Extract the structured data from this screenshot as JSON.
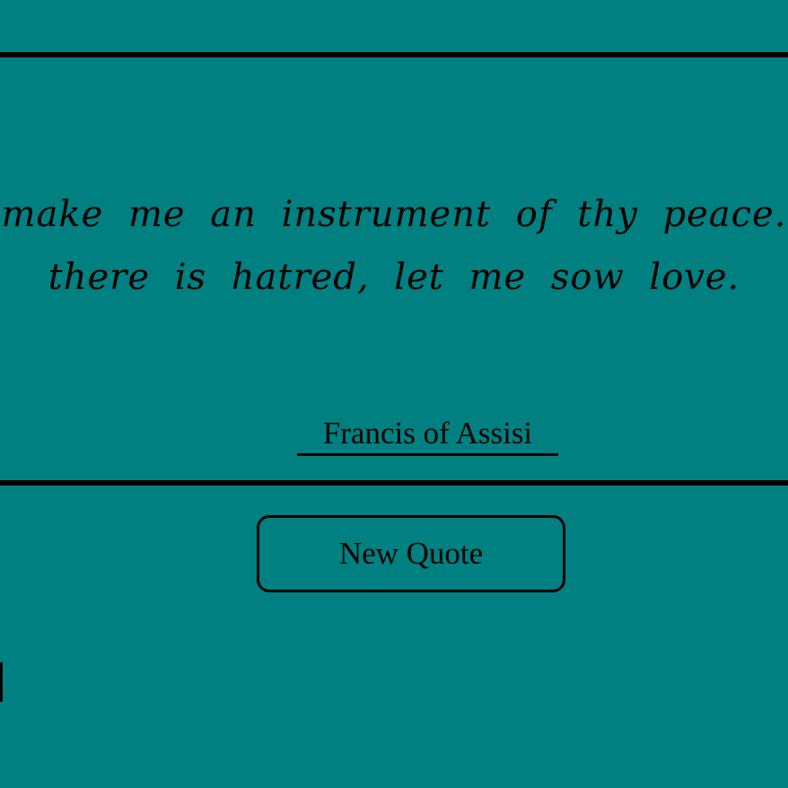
{
  "theme": {
    "background": "#008080",
    "text": "#000000",
    "rule": "#000000"
  },
  "quote": {
    "lines": [
      "make me an instrument of thy peace.",
      "there is hatred, let me sow love."
    ],
    "author": "Francis of Assisi"
  },
  "actions": {
    "new_quote_label": "New Quote"
  }
}
